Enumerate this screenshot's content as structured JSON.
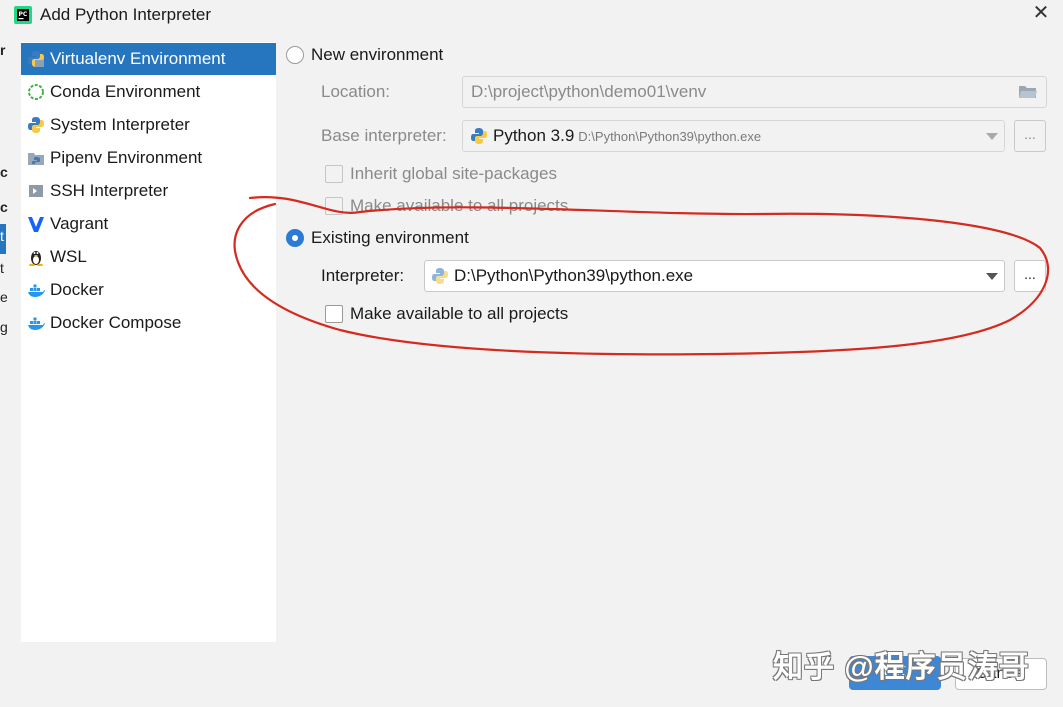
{
  "window": {
    "title": "Add Python Interpreter"
  },
  "left_edge_fragments": [
    "r",
    "c",
    "c",
    "t",
    "t",
    "e",
    "g"
  ],
  "sidebar": {
    "items": [
      {
        "label": "Virtualenv Environment",
        "icon": "virtualenv-icon",
        "selected": true
      },
      {
        "label": "Conda Environment",
        "icon": "conda-icon"
      },
      {
        "label": "System Interpreter",
        "icon": "python-icon"
      },
      {
        "label": "Pipenv Environment",
        "icon": "pipenv-icon"
      },
      {
        "label": "SSH Interpreter",
        "icon": "ssh-icon"
      },
      {
        "label": "Vagrant",
        "icon": "vagrant-icon"
      },
      {
        "label": "WSL",
        "icon": "linux-icon"
      },
      {
        "label": "Docker",
        "icon": "docker-icon"
      },
      {
        "label": "Docker Compose",
        "icon": "docker-compose-icon"
      }
    ]
  },
  "new_env": {
    "radio_label": "New environment",
    "location_label": "Location:",
    "location_value": "D:\\project\\python\\demo01\\venv",
    "base_label": "Base interpreter:",
    "base_value": "Python 3.9",
    "base_path": "D:\\Python\\Python39\\python.exe",
    "inherit_label": "Inherit global site-packages",
    "make_available_label": "Make available to all projects"
  },
  "existing_env": {
    "radio_label": "Existing environment",
    "interpreter_label": "Interpreter:",
    "interpreter_value": "D:\\Python\\Python39\\python.exe",
    "make_available_label": "Make available to all projects"
  },
  "browse_label": "...",
  "footer": {
    "ok_label": "OK",
    "cancel_label": "Cancel"
  },
  "watermark": "知乎 @程序员涛哥",
  "colors": {
    "selection": "#2675bf",
    "accent": "#2b7bd6",
    "annotation": "#d42a1f"
  }
}
